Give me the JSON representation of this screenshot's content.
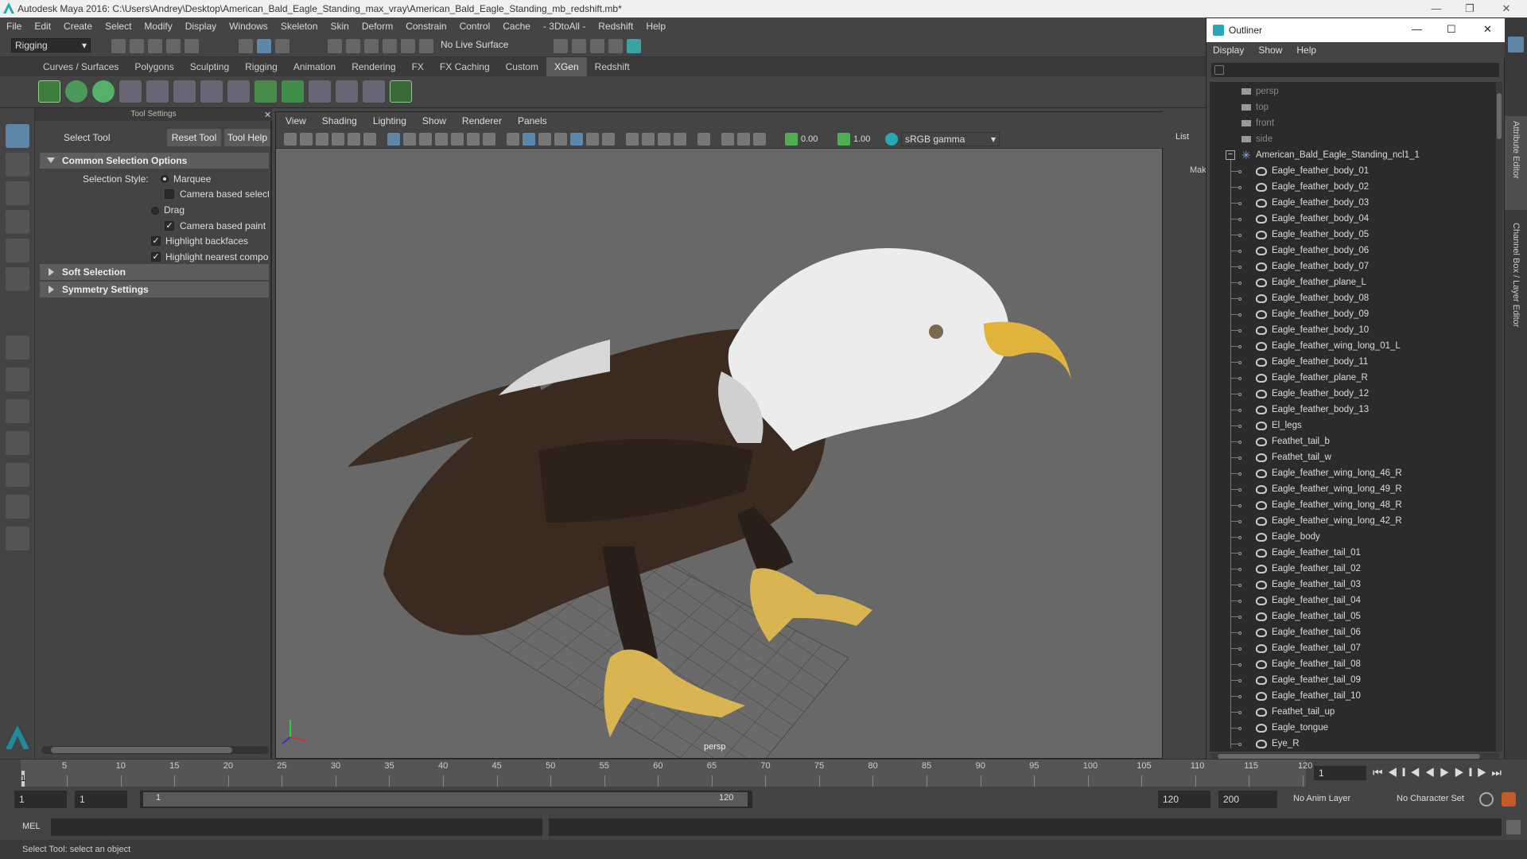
{
  "window": {
    "title": "Autodesk Maya 2016: C:\\Users\\Andrey\\Desktop\\American_Bald_Eagle_Standing_max_vray\\American_Bald_Eagle_Standing_mb_redshift.mb*"
  },
  "menu": [
    "File",
    "Edit",
    "Create",
    "Select",
    "Modify",
    "Display",
    "Windows",
    "Skeleton",
    "Skin",
    "Deform",
    "Constrain",
    "Control",
    "Cache",
    "- 3DtoAll -",
    "Redshift",
    "Help"
  ],
  "toolbar": {
    "mode": "Rigging",
    "live_surface": "No Live Surface"
  },
  "shelf_tabs": [
    "Curves / Surfaces",
    "Polygons",
    "Sculpting",
    "Rigging",
    "Animation",
    "Rendering",
    "FX",
    "FX Caching",
    "Custom",
    "XGen",
    "Redshift"
  ],
  "shelf_active": "XGen",
  "tool_settings": {
    "header": "Tool Settings",
    "tool_name": "Select Tool",
    "reset": "Reset Tool",
    "help": "Tool Help",
    "sec_common": "Common Selection Options",
    "style_label": "Selection Style:",
    "marquee": "Marquee",
    "camera_based_sel": "Camera based selectio",
    "drag": "Drag",
    "camera_based_paint": "Camera based paint se",
    "highlight_back": "Highlight backfaces",
    "highlight_near": "Highlight nearest compor",
    "sec_soft": "Soft Selection",
    "sec_sym": "Symmetry Settings"
  },
  "viewport": {
    "menu": [
      "View",
      "Shading",
      "Lighting",
      "Show",
      "Renderer",
      "Panels"
    ],
    "exposure": "0.00",
    "gamma": "1.00",
    "colorspace": "sRGB gamma",
    "camera_label": "persp"
  },
  "side_panel": {
    "list_label": "List",
    "make_label": "Mak"
  },
  "outliner": {
    "title": "Outliner",
    "menu": [
      "Display",
      "Show",
      "Help"
    ],
    "cameras": [
      "persp",
      "top",
      "front",
      "side"
    ],
    "root": "American_Bald_Eagle_Standing_ncl1_1",
    "items": [
      "Eagle_feather_body_01",
      "Eagle_feather_body_02",
      "Eagle_feather_body_03",
      "Eagle_feather_body_04",
      "Eagle_feather_body_05",
      "Eagle_feather_body_06",
      "Eagle_feather_body_07",
      "Eagle_feather_plane_L",
      "Eagle_feather_body_08",
      "Eagle_feather_body_09",
      "Eagle_feather_body_10",
      "Eagle_feather_wing_long_01_L",
      "Eagle_feather_body_11",
      "Eagle_feather_plane_R",
      "Eagle_feather_body_12",
      "Eagle_feather_body_13",
      "El_legs",
      "Feathet_tail_b",
      "Feathet_tail_w",
      "Eagle_feather_wing_long_46_R",
      "Eagle_feather_wing_long_49_R",
      "Eagle_feather_wing_long_48_R",
      "Eagle_feather_wing_long_42_R",
      "Eagle_body",
      "Eagle_feather_tail_01",
      "Eagle_feather_tail_02",
      "Eagle_feather_tail_03",
      "Eagle_feather_tail_04",
      "Eagle_feather_tail_05",
      "Eagle_feather_tail_06",
      "Eagle_feather_tail_07",
      "Eagle_feather_tail_08",
      "Eagle_feather_tail_09",
      "Eagle_feather_tail_10",
      "Feathet_tail_up",
      "Eagle_tongue",
      "Eye_R"
    ]
  },
  "right_tabs": {
    "attr": "Attribute Editor",
    "channel": "Channel Box / Layer Editor"
  },
  "timeline": {
    "labels": [
      "5",
      "10",
      "15",
      "20",
      "25",
      "30",
      "35",
      "40",
      "45",
      "50",
      "55",
      "60",
      "65",
      "70",
      "75",
      "80",
      "85",
      "90",
      "95",
      "100",
      "105",
      "110",
      "115",
      "120"
    ],
    "start_marker": "1",
    "current_frame": "1"
  },
  "range": {
    "start": "1",
    "anim_start": "1",
    "slider_start": "1",
    "slider_end": "120",
    "end": "120",
    "anim_end": "200",
    "anim_layer": "No Anim Layer",
    "char_set": "No Character Set"
  },
  "command": {
    "lang": "MEL"
  },
  "help_line": "Select Tool: select an object"
}
